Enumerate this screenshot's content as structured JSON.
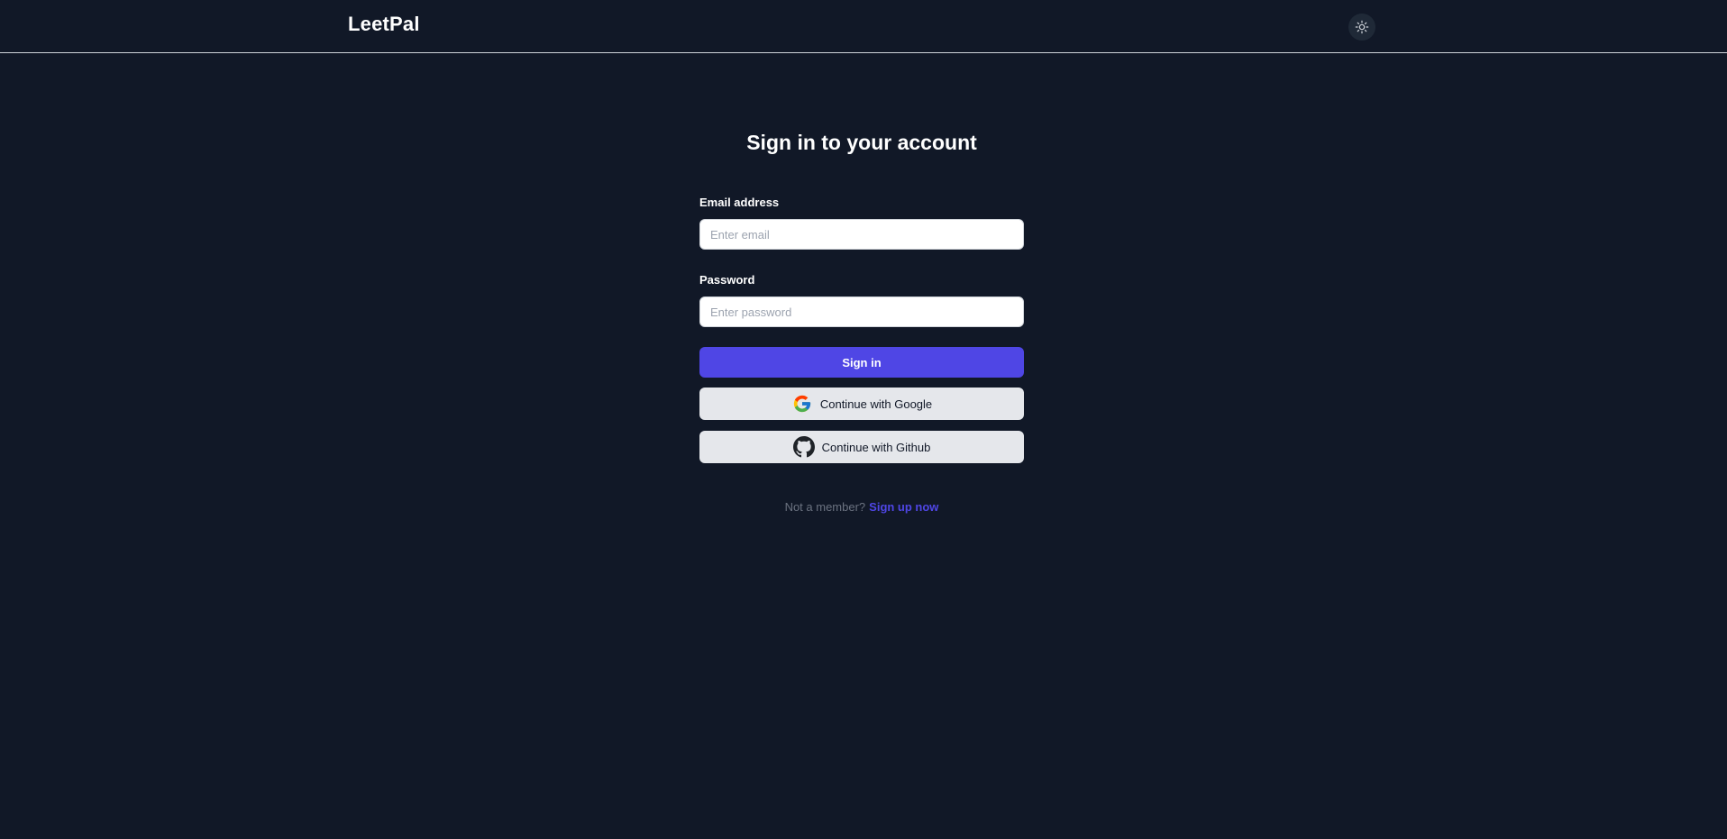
{
  "header": {
    "brand": "LeetPal",
    "theme_toggle_icon": "sun-icon"
  },
  "form": {
    "title": "Sign in to your account",
    "email": {
      "label": "Email address",
      "placeholder": "Enter email",
      "value": ""
    },
    "password": {
      "label": "Password",
      "placeholder": "Enter password",
      "value": ""
    },
    "sign_in_label": "Sign in",
    "google_label": "Continue with Google",
    "github_label": "Continue with Github"
  },
  "footer": {
    "prompt": "Not a member?",
    "signup_link": "Sign up now"
  },
  "colors": {
    "background": "#111827",
    "accent": "#4f46e5",
    "secondary_button": "#e5e7eb",
    "muted_text": "#6b7280"
  }
}
